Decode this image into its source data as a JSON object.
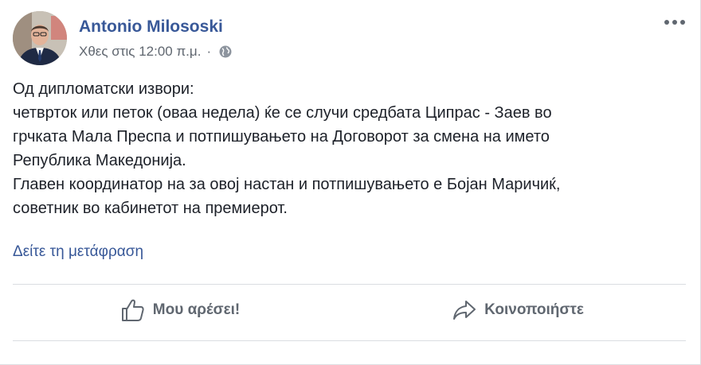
{
  "post": {
    "author": "Antonio Milososki",
    "timestamp": "Χθες στις 12:00 π.μ.",
    "separator": "·",
    "privacy_icon": "globe-icon",
    "avatar_icon": "avatar",
    "body_lines": [
      "Од дипломатски извори:",
      "четвртoк или петок (оваа недела) ќе се случи средбата Ципрас - Заев во",
      "грчката Мала Преспа и потпишувањето на Договорот за смена на името",
      "Република Македонија.",
      "Главен координатор на за овој настан и потпишувањето е Бојан Маричиќ,",
      "советник во кабинетот на премиерот."
    ],
    "translate_link": "Δείτε τη μετάφραση"
  },
  "actions": {
    "like_label": "Μου αρέσει!",
    "like_icon": "thumbs-up-icon",
    "share_label": "Κοινοποιήστε",
    "share_icon": "share-arrow-icon",
    "more_icon": "more-options-icon"
  },
  "colors": {
    "link": "#385898",
    "text": "#1d2129",
    "secondary": "#606770",
    "divider": "#dadde1"
  }
}
